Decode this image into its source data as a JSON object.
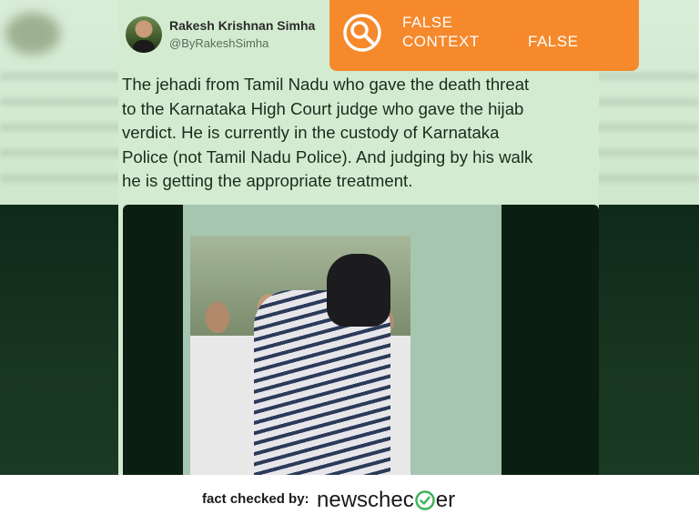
{
  "tweet": {
    "author_name": "Rakesh Krishnan Simha",
    "author_handle": "@ByRakeshSimha",
    "text": "The jehadi from Tamil Nadu who gave the death threat\nto the Karnataka High Court judge who gave the hijab\nverdict. He is currently in the custody of Karnataka\nPolice (not Tamil Nadu Police). And judging by his walk\nhe is getting the appropriate treatment."
  },
  "badge": {
    "title": "FALSE\nCONTEXT",
    "label": "FALSE",
    "color": "#f5892b",
    "icon": "magnifier-icon"
  },
  "footer": {
    "fact_checked_by": "fact checked by:",
    "brand_before": "newschec",
    "brand_after": "er",
    "brand_icon": "check-circle-icon",
    "brand_accent": "#3cb55a"
  }
}
